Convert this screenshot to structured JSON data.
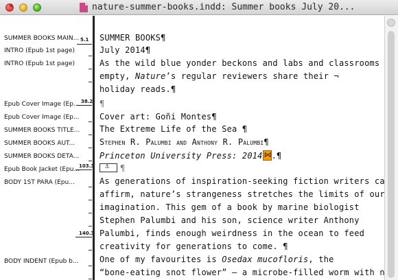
{
  "window": {
    "title": "nature-summer-books.indd: Summer books July 20..."
  },
  "style_column": {
    "entries": [
      {
        "label": "SUMMER BOOKS MAIN...",
        "depth": "5.1"
      },
      {
        "label": "INTRO (Epub 1st page)",
        "depth": ""
      },
      {
        "label": "INTRO (Epub 1st page)",
        "depth": ""
      },
      {
        "label": "Epub Cover Image (Ep...",
        "depth": "38.2"
      },
      {
        "label": "Epub Cover Image (Ep...",
        "depth": ""
      },
      {
        "label": "SUMMER BOOKS TITLE...",
        "depth": ""
      },
      {
        "label": "SUMMER BOOKS AUT...",
        "depth": ""
      },
      {
        "label": "SUMMER BOOKS DETA...",
        "depth": ""
      },
      {
        "label": "Epub Book Jacket (Epu...",
        "depth": "103.3"
      },
      {
        "label": "BODY 1ST PARA (Epu...",
        "depth": ""
      },
      {
        "label": "",
        "depth": "140.3"
      },
      {
        "label": "BODY INDENT (Epub b...",
        "depth": ""
      }
    ]
  },
  "story": {
    "lines": [
      "SUMMER BOOKS¶",
      "July 2014¶",
      "As the wild blue yonder beckons and labs and classrooms",
      "empty, ",
      "holiday reads.¶",
      "¶",
      "Cover art: Goñi Montes¶",
      "The Extreme Life of the Sea ¶",
      "Stephen R. Palumbi and Anthony R. Palumbi¶",
      "Princeton University Press: 2014",
      "¶",
      "As generations of inspiration-seeking fiction writers can",
      "affirm, nature’s strangeness stretches the limits of our",
      "imagination. This gem of a book by marine biologist",
      "Stephen Palumbi and his son, science writer Anthony",
      "Palumbi, finds enough weirdness in the ocean to feed",
      "creativity for generations to come. ¶",
      "One of my favourites is ",
      "“bone-eating snot flower” — a microbe-filled worm with no"
    ],
    "line4_italic": "Nature",
    "line4_rest": "’s regular reviewers share their ¬",
    "line10_tail": ".¶",
    "line18_italic": "Osedax mucofloris",
    "line18_rest": ", the"
  },
  "colors": {
    "note_marker": "#f39c12",
    "window_close": "#e0443a",
    "window_minimize": "#e8b22c",
    "window_zoom": "#4fb52f"
  }
}
